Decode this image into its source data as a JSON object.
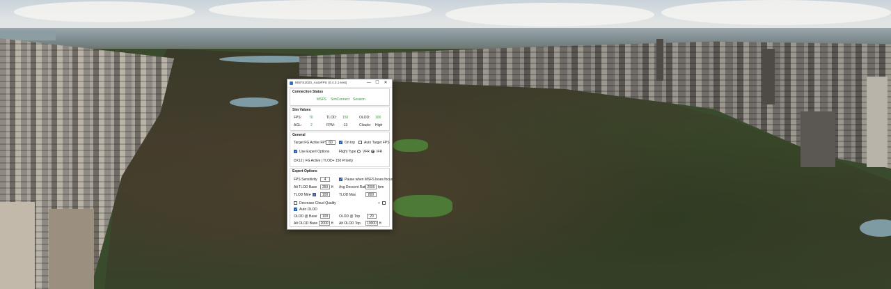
{
  "window": {
    "title": "MSFS2020_AutoFPS (0.4.3.1-test)",
    "minimize_glyph": "—",
    "maximize_glyph": "☐",
    "close_glyph": "✕",
    "app_icon": "app-icon"
  },
  "connection": {
    "header": "Connection Status",
    "items": [
      "MSFS",
      "SimConnect",
      "Session"
    ]
  },
  "sim_values": {
    "header": "Sim Values",
    "fps_label": "FPS:",
    "fps_value": "70",
    "tlod_label": "TLOD:",
    "tlod_value": "150",
    "olod_label": "OLOD:",
    "olod_value": "100",
    "agl_label": "AGL:",
    "agl_value": "2",
    "fpm_label": "FPM:",
    "fpm_value": "-13",
    "clouds_label": "Clouds:",
    "clouds_value": "High"
  },
  "general": {
    "header": "General",
    "target_fps_label": "Target FG Active FPS",
    "target_fps_value": "60",
    "on_top_label": "On top",
    "on_top_checked": true,
    "auto_target_label": "Auto Target FPS",
    "auto_target_checked": false,
    "expert_label": "Use Expert Options",
    "expert_checked": true,
    "flight_type_label": "Flight Type",
    "vfr_label": "VFR",
    "ifr_label": "IFR",
    "flight_type_selected": "IFR",
    "status_text": "DX12 | FG Active | TLOD+ 150 Priority"
  },
  "expert": {
    "header": "Expert Options",
    "fps_sensitivity_label": "FPS Sensitivity",
    "fps_sensitivity_value": "4",
    "pause_label": "Pause when MSFS loses focus",
    "pause_checked": true,
    "alt_tlod_base_label": "Alt TLOD Base",
    "alt_tlod_base_value": "250",
    "alt_tlod_base_unit": "ft",
    "avg_descent_label": "Avg Descent Rate",
    "avg_descent_value": "2000",
    "avg_descent_unit": "fpm",
    "tlod_min_label": "TLOD Min",
    "tlod_min_plus": "+",
    "tlod_min_checked": true,
    "tlod_min_value": "100",
    "tlod_max_label": "TLOD Max",
    "tlod_max_value": "800",
    "decrease_cloud_label": "Decrease Cloud Quality",
    "decrease_cloud_checked": false,
    "cloud_plus": "+",
    "cloud_extra_checked": false,
    "auto_olod_label": "Auto OLOD",
    "auto_olod_checked": true,
    "olod_base_label": "OLOD @ Base",
    "olod_base_value": "100",
    "olod_top_label": "OLOD @ Top",
    "olod_top_value": "20",
    "alt_olod_base_label": "Alt OLOD Base",
    "alt_olod_base_value": "2000",
    "alt_olod_base_unit": "ft",
    "alt_olod_top_label": "Alt OLOD Top",
    "alt_olod_top_value": "10000",
    "alt_olod_top_unit": "ft"
  },
  "colors": {
    "status_green": "#2e9b3a",
    "checkbox_accent": "#2a5aa8"
  }
}
